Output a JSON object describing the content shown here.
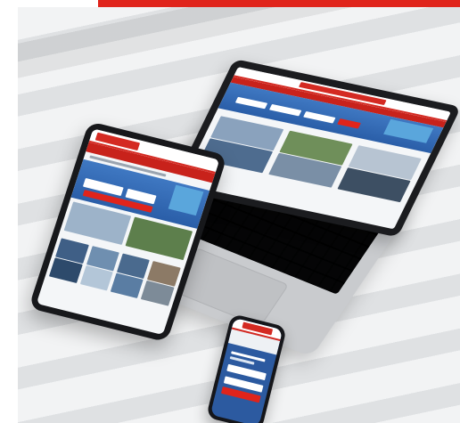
{
  "scene": {
    "accent_red": "#e0241b",
    "site_blue": "#2c5aa0",
    "devices": [
      "laptop",
      "tablet",
      "phone"
    ]
  }
}
